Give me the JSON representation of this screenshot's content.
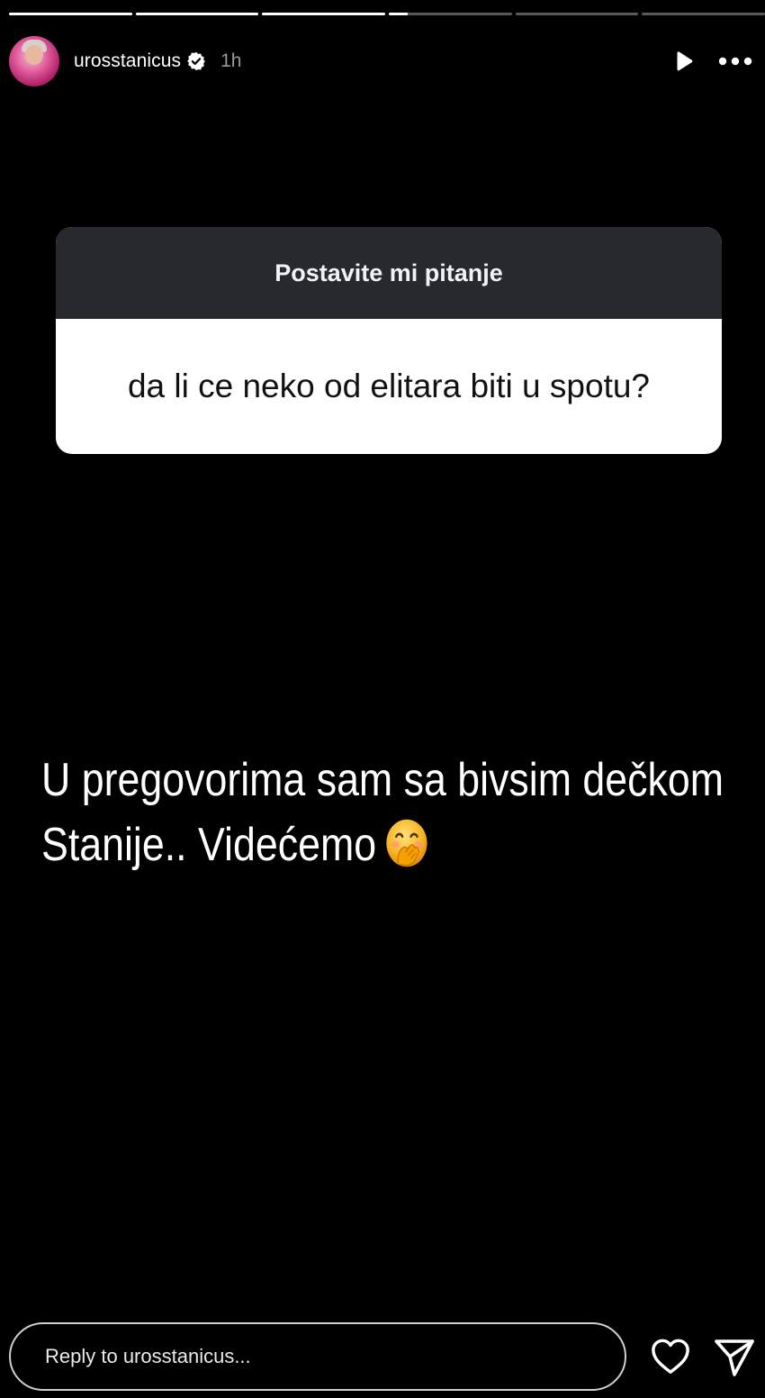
{
  "story": {
    "progress_segments": [
      1,
      1,
      1,
      0.15,
      0,
      0
    ],
    "username": "urosstanicus",
    "verified": true,
    "time_ago": "1h",
    "question_box": {
      "title": "Postavite mi pitanje",
      "question": "da li ce neko od elitara biti u spotu?"
    },
    "answer": {
      "line1": "U pregovorima sam sa bivsim dečkom",
      "line2": "Stanije..  Videćemo"
    }
  },
  "footer": {
    "reply_placeholder": "Reply to urosstanicus..."
  },
  "icons": {
    "play": "play-icon",
    "more": "more-horizontal-icon",
    "verified": "verified-badge-icon",
    "heart": "heart-icon",
    "send": "send-icon",
    "emoji": "face-with-hand-over-mouth-emoji"
  },
  "colors": {
    "background": "#000000",
    "question_header": "#262a2f",
    "question_body": "#ffffff",
    "verified_badge": "#ffffff",
    "emoji_face": "#f6b21f"
  }
}
